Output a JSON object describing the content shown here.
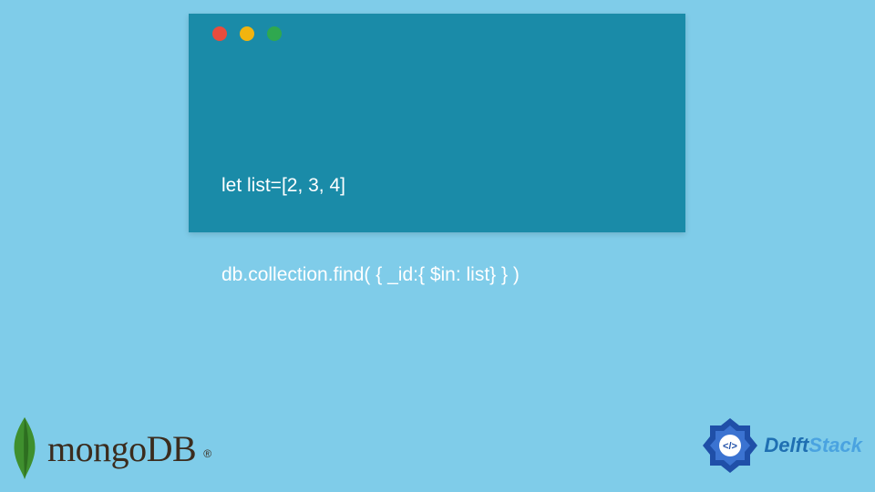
{
  "code": {
    "lines": [
      "let list=[2, 3, 4]",
      "db.collection.find( { _id:{ $in: list} } )"
    ],
    "traffic_light_colors": {
      "red": "#e94c3d",
      "yellow": "#f1b40f",
      "green": "#2fa84f"
    },
    "window_bg": "#1a8ba8",
    "text_color": "#ffffff"
  },
  "page_bg": "#7fcce9",
  "mongo": {
    "name": "mongoDB",
    "registered_mark": "®",
    "leaf_color": "#3f8f2e"
  },
  "delft": {
    "name_part1": "Delft",
    "name_part2": "Stack",
    "emblem_color": "#1f4fa8",
    "emblem_text": "</>"
  }
}
